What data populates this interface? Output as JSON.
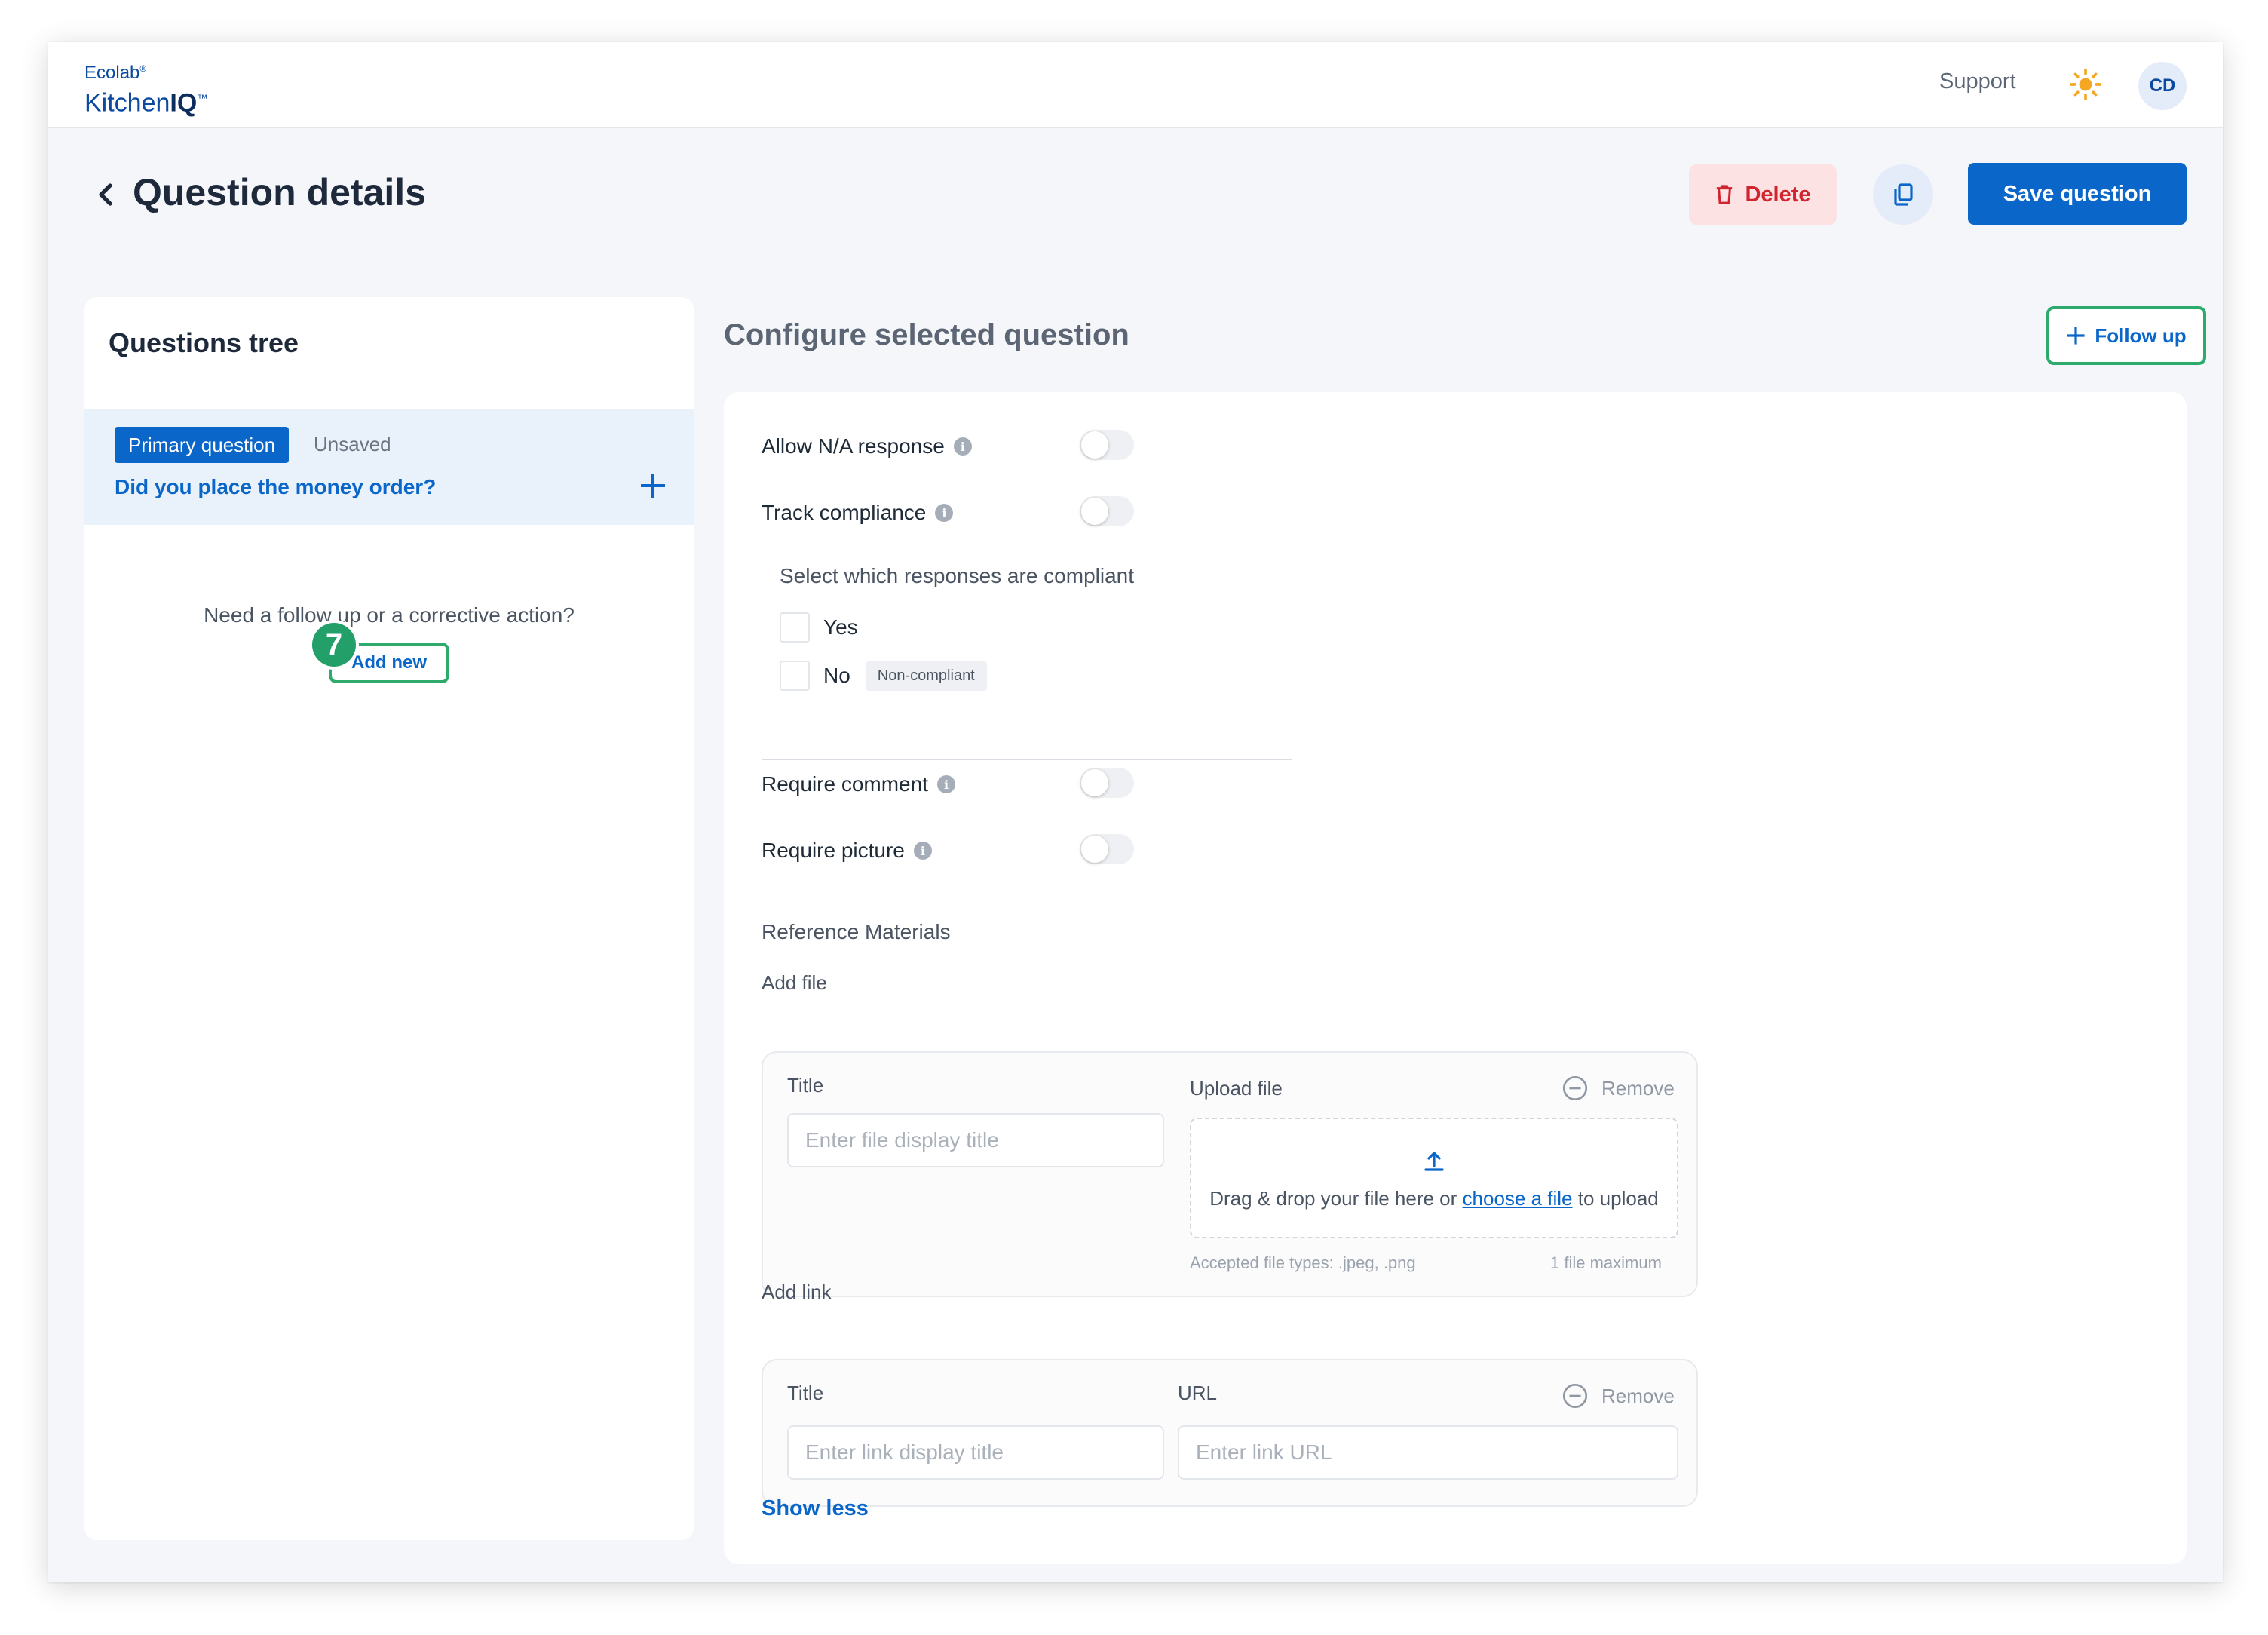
{
  "brand": {
    "company": "Ecolab",
    "product_prefix": "Kitchen",
    "product_suffix": "IQ",
    "reg": "®",
    "tm": "™"
  },
  "topbar": {
    "support_label": "Support",
    "theme_icon": "sun-icon",
    "avatar_initials": "CD"
  },
  "header": {
    "title": "Question details",
    "delete_label": "Delete",
    "save_label": "Save question"
  },
  "tree": {
    "title": "Questions tree",
    "badge": "Primary question",
    "status": "Unsaved",
    "question": "Did you place the money order?",
    "empty_prompt": "Need a follow up or a corrective action?",
    "add_new_label": "Add new",
    "step_number": "7"
  },
  "configure": {
    "title": "Configure selected question",
    "follow_up_label": "Follow up",
    "allow_na_label": "Allow N/A response",
    "track_compliance_label": "Track compliance",
    "compliance_prompt": "Select which responses are compliant",
    "responses": [
      {
        "label": "Yes",
        "checked": false
      },
      {
        "label": "No",
        "checked": false,
        "badge": "Non-compliant"
      }
    ],
    "require_comment_label": "Require comment",
    "require_picture_label": "Require picture",
    "toggles": {
      "allow_na": false,
      "track_compliance": false,
      "require_comment": false,
      "require_picture": false
    },
    "reference_title": "Reference Materials",
    "add_file": {
      "label": "Add file",
      "title_label": "Title",
      "title_placeholder": "Enter file display title",
      "upload_label": "Upload file",
      "remove_label": "Remove",
      "drop_text_before": "Drag & drop your file here or",
      "drop_link": "choose a file",
      "drop_text_after": "to upload",
      "accepted_types": "Accepted file types: .jpeg, .png",
      "max_files": "1 file maximum"
    },
    "add_link": {
      "label": "Add link",
      "title_label": "Title",
      "title_placeholder": "Enter link display title",
      "url_label": "URL",
      "url_placeholder": "Enter link URL",
      "remove_label": "Remove"
    },
    "show_less_label": "Show less"
  },
  "colors": {
    "primary": "#0a66c9",
    "danger": "#d1242f",
    "highlight": "#2faa6d",
    "sun": "#f5a623"
  }
}
